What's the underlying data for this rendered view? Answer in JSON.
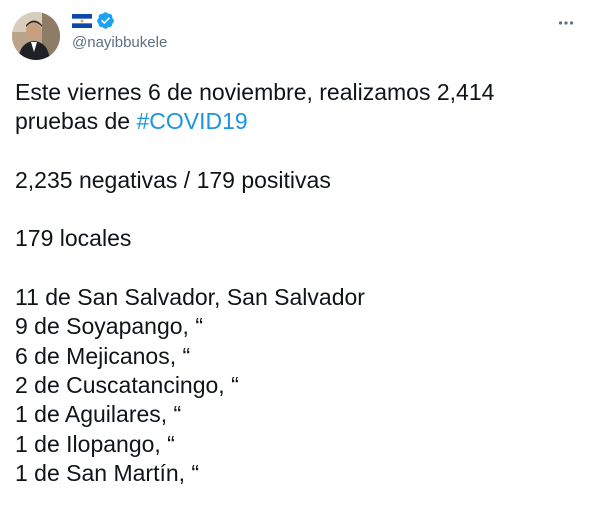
{
  "user": {
    "display_name": "🇸🇻",
    "handle": "@nayibbukele",
    "verified": true,
    "flag_colors": {
      "blue": "#0f47af",
      "white": "#ffffff"
    },
    "verified_color": "#1da1f2"
  },
  "icons": {
    "verified": "verified-badge-icon",
    "more": "more-options-icon",
    "flag": "el-salvador-flag-icon"
  },
  "tweet": {
    "line1": "Este viernes 6 de noviembre, realizamos 2,414",
    "line2_prefix": "pruebas de ",
    "hashtag": "#COVID19",
    "results": "2,235 negativas / 179 positivas",
    "locales": "179 locales",
    "places": [
      "11 de San Salvador, San Salvador",
      "9 de Soyapango, “",
      "6 de Mejicanos, “",
      "2 de Cuscatancingo, “",
      "1 de Aguilares, “",
      "1 de Ilopango, “",
      "1 de San Martín, “"
    ]
  },
  "colors": {
    "text": "#0f1419",
    "secondary": "#5b7083",
    "link": "#1b95e0"
  }
}
